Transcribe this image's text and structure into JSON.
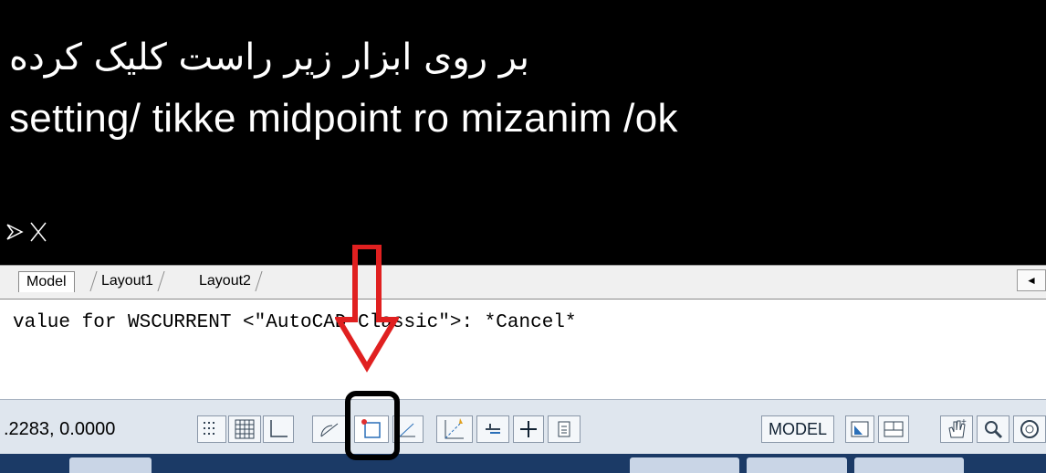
{
  "annotation": {
    "line1": "بر روی ابزار زیر راست کلیک کرده",
    "line2": "setting/ tikke midpoint ro mizanim /ok"
  },
  "tabs": {
    "model": "Model",
    "layout1": "Layout1",
    "layout2": "Layout2"
  },
  "command_line": {
    "text": "value for WSCURRENT <\"AutoCAD Classic\">: *Cancel*"
  },
  "status_bar": {
    "coordinates": ".2283, 0.0000",
    "model_label": "MODEL"
  },
  "colors": {
    "arrow": "#e02020",
    "canvas": "#000000",
    "status_bg": "#dfe6ee"
  }
}
